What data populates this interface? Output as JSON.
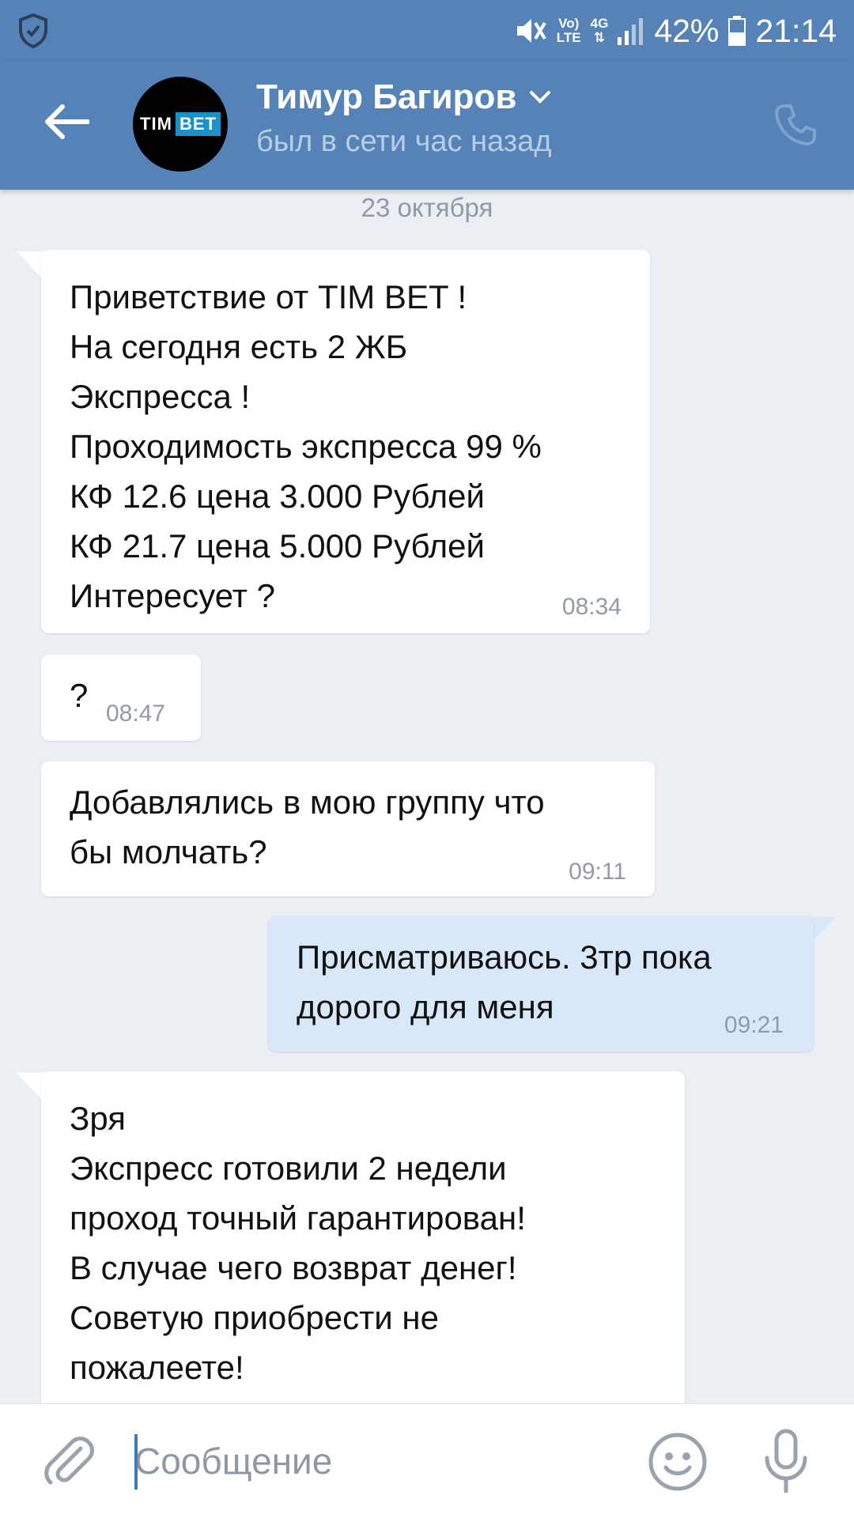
{
  "status_bar": {
    "volte_label_top": "Vo)",
    "volte_label_bottom": "LTE",
    "network_label": "4G",
    "battery": "42%",
    "time": "21:14"
  },
  "header": {
    "avatar_text_left": "TIM",
    "avatar_text_right": "BET",
    "contact_name": "Тимур Багиров",
    "contact_status": "был в сети час назад"
  },
  "chat": {
    "date_separator": "23 октября",
    "messages": [
      {
        "direction": "in",
        "text": "Приветствие от TIM BET !\nНа сегодня есть 2 ЖБ\nЭкспресса !\nПроходимость экспресса 99 %\nКФ 12.6 цена 3.000 Рублей\nКФ 21.7 цена 5.000 Рублей\nИнтересует ?",
        "time": "08:34"
      },
      {
        "direction": "in",
        "text": "?",
        "time": "08:47"
      },
      {
        "direction": "in",
        "text": "Добавлялись в мою группу что\nбы молчать?",
        "time": "09:11"
      },
      {
        "direction": "out",
        "text": "Присматриваюсь. 3тр пока\nдорого для меня",
        "time": "09:21"
      },
      {
        "direction": "in",
        "text": "Зря\nЭкспресс готовили 2 недели\nпроход точный гарантирован!\nВ случае чего возврат денег!\nСоветую приобрести не\nпожалеете!",
        "time": ""
      }
    ]
  },
  "composer": {
    "placeholder": "Сообщение",
    "value": ""
  },
  "colors": {
    "header_bg": "#5582b7",
    "chat_bg": "#ebeef3",
    "incoming_bubble": "#ffffff",
    "outgoing_bubble": "#d9e8f8",
    "icon_gray": "#99a2ad"
  },
  "icons": {
    "status_shield": "shield-icon",
    "mute": "mute-icon",
    "signal": "signal-icon",
    "battery": "battery-icon",
    "back": "arrow-left-icon",
    "dropdown": "chevron-down-icon",
    "call": "phone-icon",
    "attach": "paperclip-icon",
    "emoji": "smiley-icon",
    "mic": "microphone-icon"
  }
}
